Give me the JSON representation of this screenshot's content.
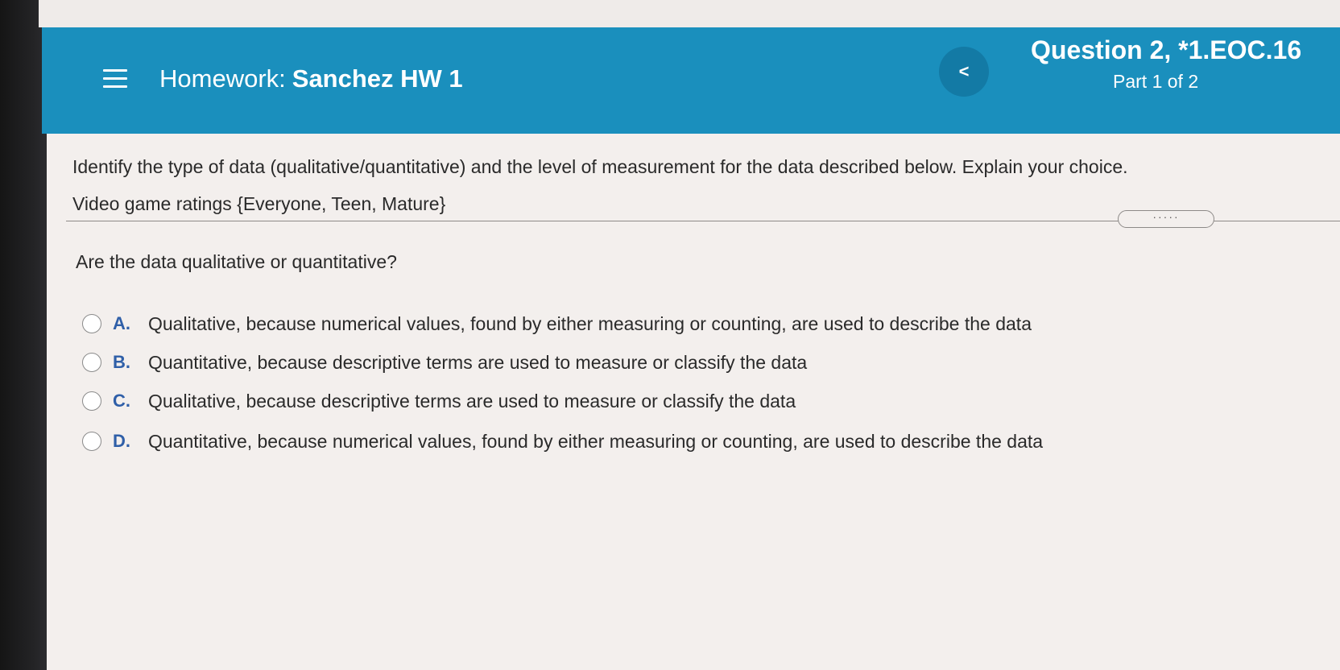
{
  "header": {
    "homework_label": "Homework:",
    "homework_name": "Sanchez HW 1",
    "back_symbol": "<",
    "question_title": "Question 2, *1.EOC.16",
    "part": "Part 1 of 2",
    "background": "#1a8fbd"
  },
  "question": {
    "prompt_line1": "Identify the type of data (qualitative/quantitative) and the level of measurement for the data described below. Explain your choice.",
    "prompt_line2": "Video game ratings {Everyone, Teen, Mature}",
    "more_label": "·····",
    "sub_question": "Are the data qualitative or quantitative?",
    "options": [
      {
        "letter": "A.",
        "text": "Qualitative, because numerical values, found by either measuring or counting, are used to describe the data"
      },
      {
        "letter": "B.",
        "text": "Quantitative, because descriptive terms are used to measure or classify the data"
      },
      {
        "letter": "C.",
        "text": "Qualitative, because descriptive terms are used to measure or classify the data"
      },
      {
        "letter": "D.",
        "text": "Quantitative, because numerical values, found by either measuring or counting, are used to describe the data"
      }
    ],
    "accent_color": "#2f5fa8"
  },
  "icons": {
    "menu": "hamburger-icon",
    "back": "chevron-left-icon"
  }
}
